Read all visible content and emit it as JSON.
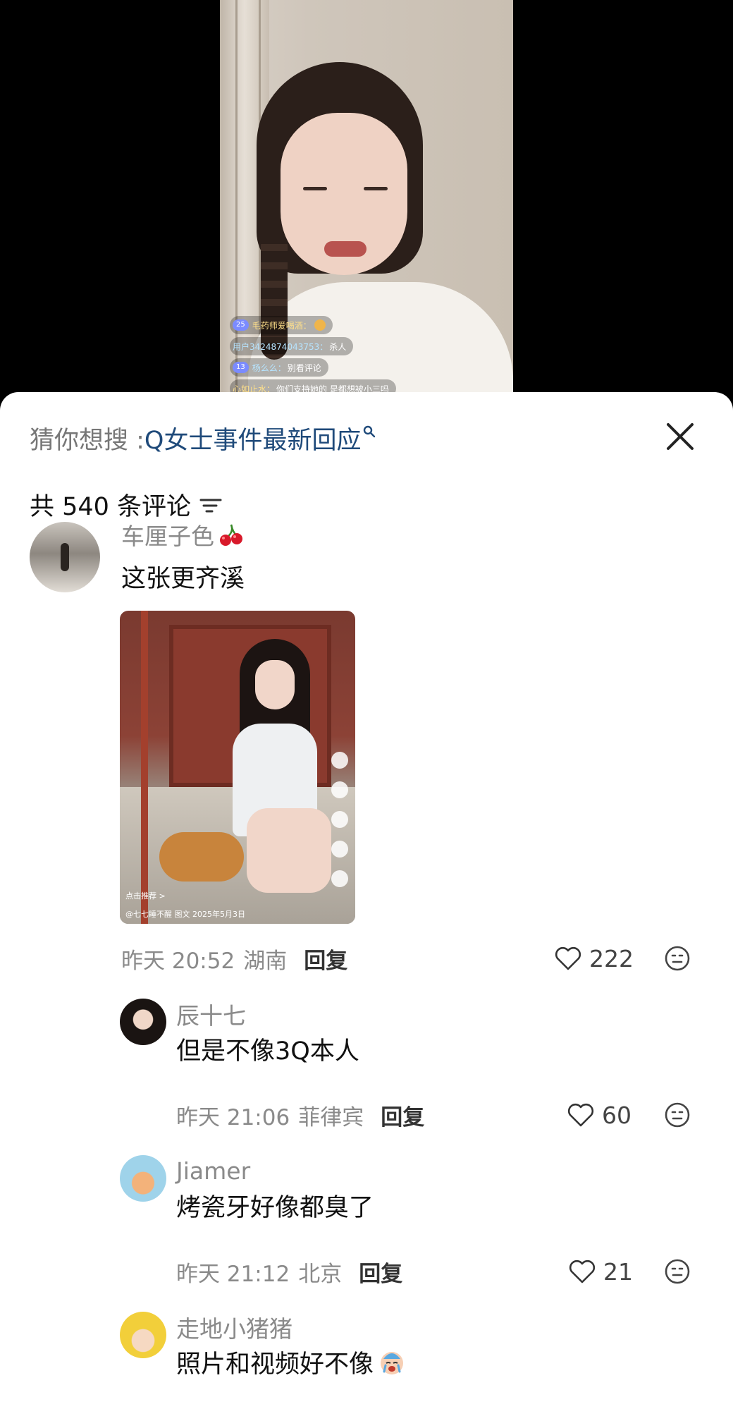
{
  "live": {
    "comments": [
      {
        "badge": "25",
        "user": "毛药师爱喝酒：",
        "text": "",
        "has_badge": true,
        "has_emoji": true
      },
      {
        "badge": "",
        "user": "用户3424874043753：",
        "text": "杀人",
        "has_badge": false,
        "has_emoji": false
      },
      {
        "badge": "13",
        "user": "杨么么：",
        "text": "别看评论",
        "has_badge": true,
        "has_emoji": false
      },
      {
        "badge": "",
        "user": "心如止水：",
        "text": "你们支持她的 是都想被小三吗",
        "has_badge": false,
        "has_emoji": false
      }
    ]
  },
  "panel": {
    "search_hint_label": "猜你想搜 : ",
    "search_hint_query": "Q女士事件最新回应",
    "comment_count_label": "共 540 条评论"
  },
  "comments": [
    {
      "user": "车厘子色",
      "text": "这张更齐溪",
      "time": "昨天 20:52",
      "location": "湖南",
      "reply_label": "回复",
      "likes": "222",
      "photo": {
        "recommend": "点击推荐 >",
        "caption": "@七七睡不醒  图文  2025年5月3日"
      }
    },
    {
      "user": "辰十七",
      "text": "但是不像3Q本人",
      "time": "昨天 21:06",
      "location": "菲律宾",
      "reply_label": "回复",
      "likes": "60"
    },
    {
      "user": "Jiamer",
      "text": "烤瓷牙好像都臭了",
      "time": "昨天 21:12",
      "location": "北京",
      "reply_label": "回复",
      "likes": "21"
    },
    {
      "user": "走地小猪猪",
      "text": "照片和视频好不像"
    }
  ],
  "colors": {
    "query_blue": "#1f4a7a",
    "meta_gray": "#8a8a8a",
    "panel_bg": "#ffffff"
  },
  "icons": {
    "close": "close-icon",
    "sort": "sort-icon",
    "like": "heart-outline-icon",
    "emote": "emoji-face-icon",
    "cherry": "cherry-emoji-icon",
    "crying": "crying-baby-emoji-icon"
  }
}
